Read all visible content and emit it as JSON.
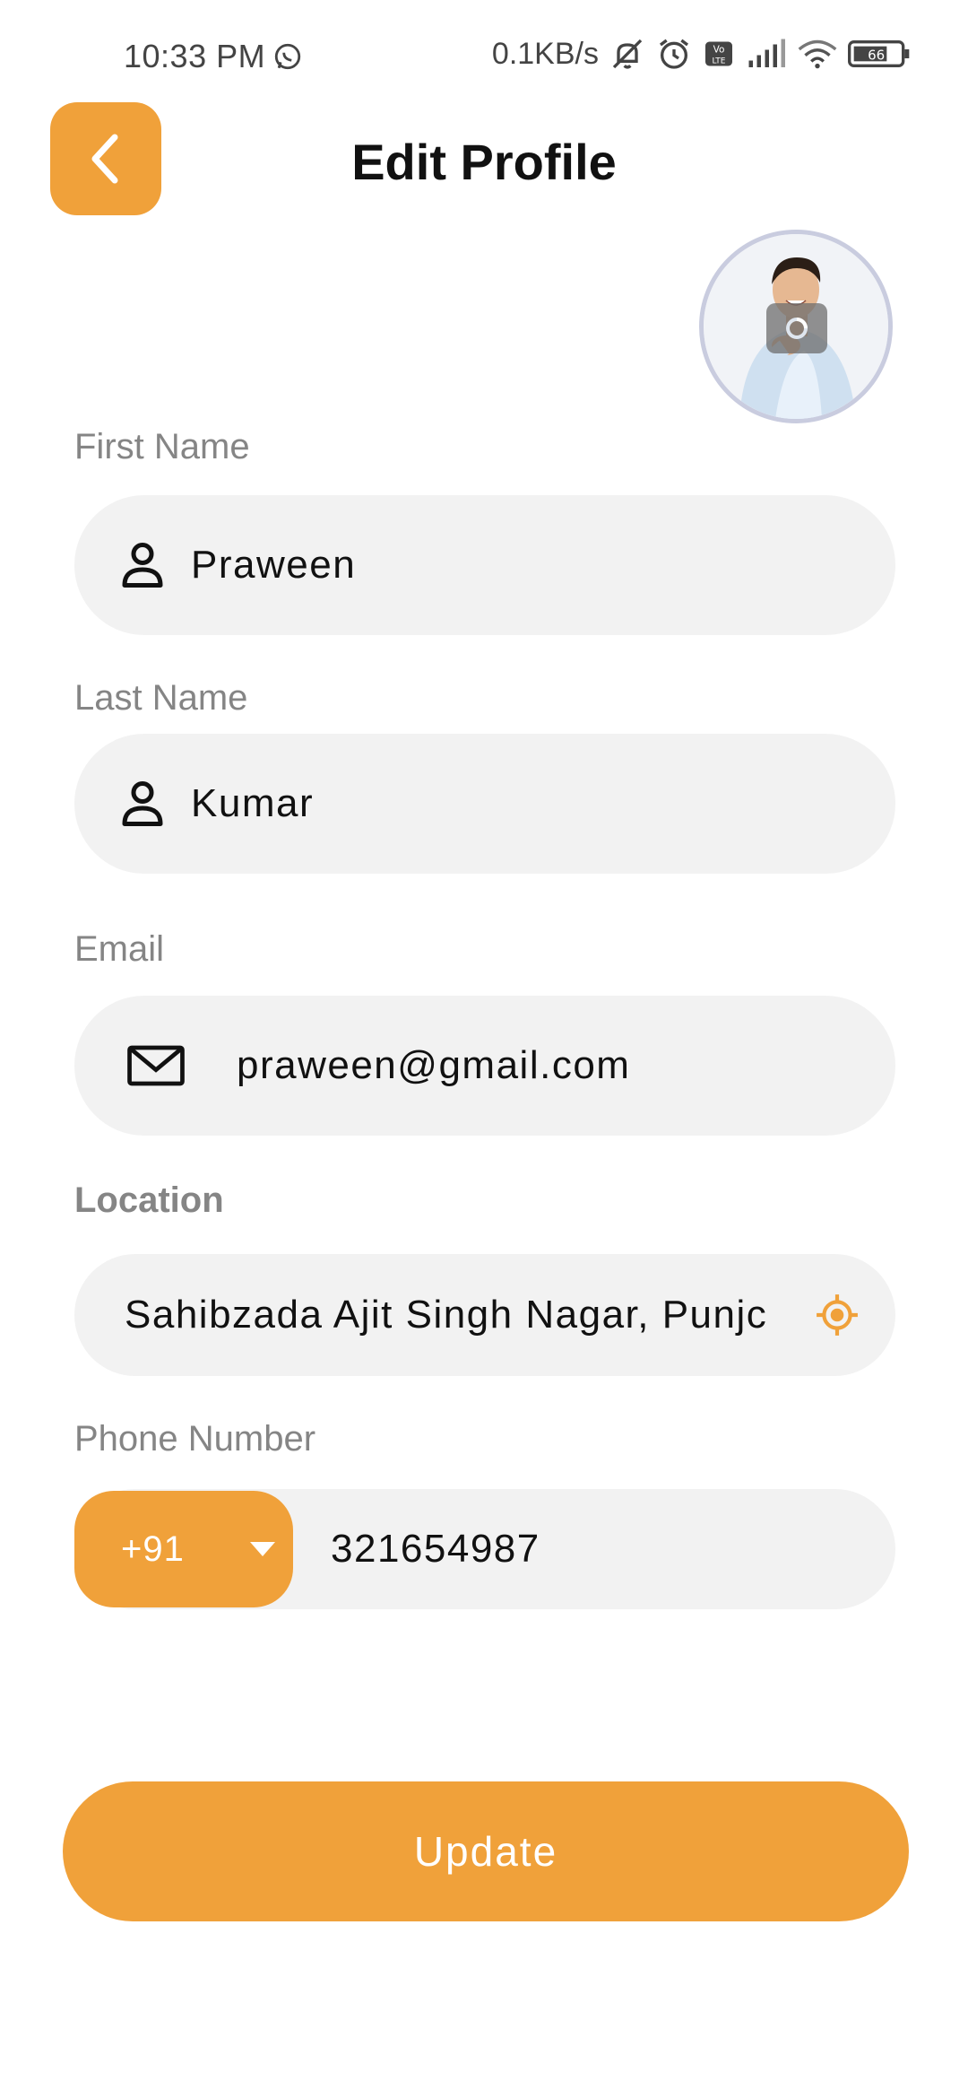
{
  "status_bar": {
    "time": "10:33 PM",
    "network_speed": "0.1KB/s",
    "battery": "66",
    "icons": [
      "whatsapp-icon",
      "mute-icon",
      "alarm-icon",
      "volte-icon",
      "signal-icon",
      "wifi-icon",
      "battery-icon"
    ]
  },
  "header": {
    "title": "Edit Profile",
    "back_icon": "chevron-left-icon"
  },
  "avatar": {
    "overlay_icon": "camera-icon"
  },
  "form": {
    "first_name": {
      "label": "First Name",
      "value": "Praween",
      "icon": "person-icon"
    },
    "last_name": {
      "label": "Last Name",
      "value": "Kumar",
      "icon": "person-icon"
    },
    "email": {
      "label": "Email",
      "value": "praween@gmail.com",
      "icon": "mail-icon"
    },
    "location": {
      "label": "Location",
      "value": "Sahibzada Ajit Singh Nagar, Punjc",
      "icon": "crosshair-icon"
    },
    "phone": {
      "label": "Phone Number",
      "country_code": "+91",
      "value": "321654987",
      "dropdown_icon": "caret-down-icon"
    }
  },
  "update_button": {
    "label": "Update"
  },
  "colors": {
    "accent": "#F0A13A",
    "field_bg": "#F2F2F2",
    "label": "#858585"
  }
}
